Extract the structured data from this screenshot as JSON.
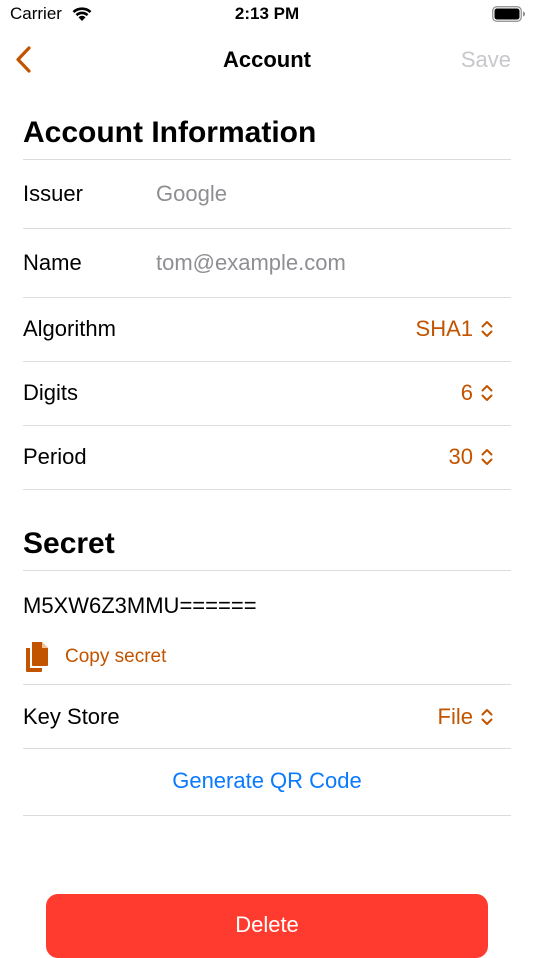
{
  "status_bar": {
    "carrier": "Carrier",
    "time": "2:13 PM"
  },
  "nav": {
    "title": "Account",
    "save_label": "Save",
    "back_icon": "chevron-left"
  },
  "account_info": {
    "title": "Account Information",
    "issuer": {
      "label": "Issuer",
      "placeholder": "Google"
    },
    "name": {
      "label": "Name",
      "placeholder": "tom@example.com"
    },
    "algorithm": {
      "label": "Algorithm",
      "value": "SHA1"
    },
    "digits": {
      "label": "Digits",
      "value": "6"
    },
    "period": {
      "label": "Period",
      "value": "30"
    }
  },
  "secret": {
    "title": "Secret",
    "value": "M5XW6Z3MMU======",
    "copy_label": "Copy secret",
    "key_store": {
      "label": "Key Store",
      "value": "File"
    },
    "generate_qr_label": "Generate QR Code"
  },
  "delete_label": "Delete",
  "colors": {
    "accent": "#c25400",
    "link": "#0a7aff",
    "destructive": "#ff3b30",
    "placeholder": "#8e8e93",
    "disabled": "#c7c7cc"
  }
}
